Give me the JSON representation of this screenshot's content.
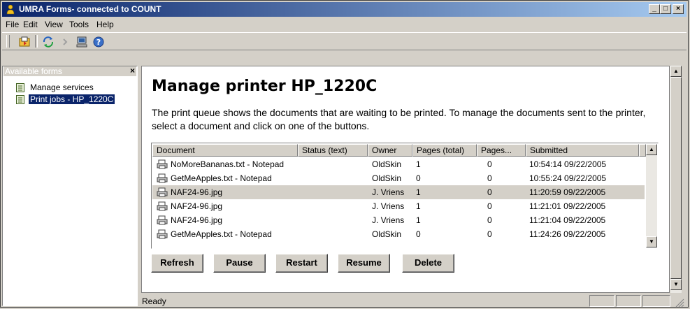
{
  "window": {
    "title": "UMRA Forms- connected to COUNT"
  },
  "menu": {
    "items": [
      "File",
      "Edit",
      "View",
      "Tools",
      "Help"
    ]
  },
  "toolbar": {
    "icons": [
      "open-form-icon",
      "refresh-icon",
      "disabled-icon",
      "computer-icon",
      "help-icon"
    ]
  },
  "sidebar": {
    "header": "Available forms",
    "items": [
      {
        "label": "Manage services"
      },
      {
        "label": "Print jobs - HP_1220C"
      }
    ]
  },
  "main": {
    "title": "Manage printer HP_1220C",
    "description": "The print queue shows the documents that are waiting to be printed. To manage the documents sent to the printer, select a document and click on one of the buttons."
  },
  "table": {
    "columns": [
      "Document",
      "Status (text)",
      "Owner",
      "Pages (total)",
      "Pages...",
      "Submitted"
    ],
    "rows": [
      {
        "document": "NoMoreBananas.txt - Notepad",
        "status": "",
        "owner": "OldSkin",
        "pages_total": "1",
        "pages": "0",
        "submitted": "10:54:14 09/22/2005"
      },
      {
        "document": "GetMeApples.txt - Notepad",
        "status": "",
        "owner": "OldSkin",
        "pages_total": "0",
        "pages": "0",
        "submitted": "10:55:24 09/22/2005"
      },
      {
        "document": "NAF24-96.jpg",
        "status": "",
        "owner": "J. Vriens",
        "pages_total": "1",
        "pages": "0",
        "submitted": "11:20:59 09/22/2005"
      },
      {
        "document": "NAF24-96.jpg",
        "status": "",
        "owner": "J. Vriens",
        "pages_total": "1",
        "pages": "0",
        "submitted": "11:21:01 09/22/2005"
      },
      {
        "document": "NAF24-96.jpg",
        "status": "",
        "owner": "J. Vriens",
        "pages_total": "1",
        "pages": "0",
        "submitted": "11:21:04 09/22/2005"
      },
      {
        "document": "GetMeApples.txt - Notepad",
        "status": "",
        "owner": "OldSkin",
        "pages_total": "0",
        "pages": "0",
        "submitted": "11:24:26 09/22/2005"
      }
    ],
    "selected_row": 2
  },
  "buttons": {
    "refresh": "Refresh",
    "pause": "Pause",
    "restart": "Restart",
    "resume": "Resume",
    "delete": "Delete"
  },
  "status": {
    "text": "Ready"
  },
  "colors": {
    "title_start": "#0a246a",
    "title_end": "#a6caf0",
    "face": "#d4d0c8",
    "selection": "#0a246a"
  }
}
